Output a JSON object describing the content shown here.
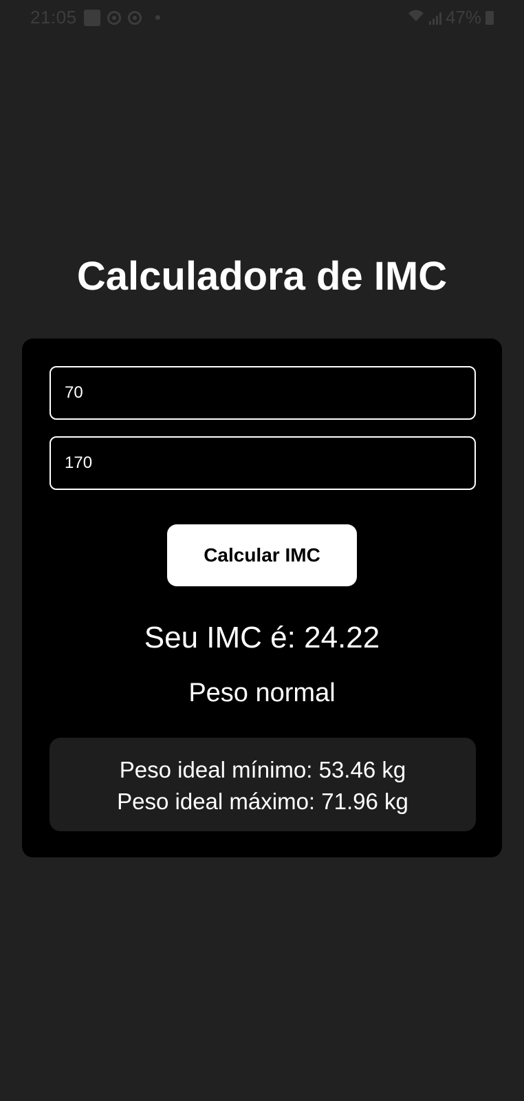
{
  "status_bar": {
    "time": "21:05",
    "battery": "47%",
    "icons": [
      "gallery-icon",
      "chrome-icon",
      "chrome-icon",
      "dot-icon",
      "wifi-icon",
      "signal-icon",
      "battery-icon"
    ]
  },
  "app": {
    "title": "Calculadora de IMC"
  },
  "form": {
    "weight_value": "70",
    "height_value": "170",
    "calculate_label": "Calcular IMC"
  },
  "result": {
    "bmi_text": "Seu IMC é: 24.22",
    "category": "Peso normal"
  },
  "ideal_weight": {
    "min_text": "Peso ideal mínimo: 53.46 kg",
    "max_text": "Peso ideal máximo: 71.96 kg"
  },
  "colors": {
    "background": "#212121",
    "card": "#000000",
    "ideal_box": "#1e1e1e",
    "text": "#ffffff",
    "button": "#ffffff"
  }
}
